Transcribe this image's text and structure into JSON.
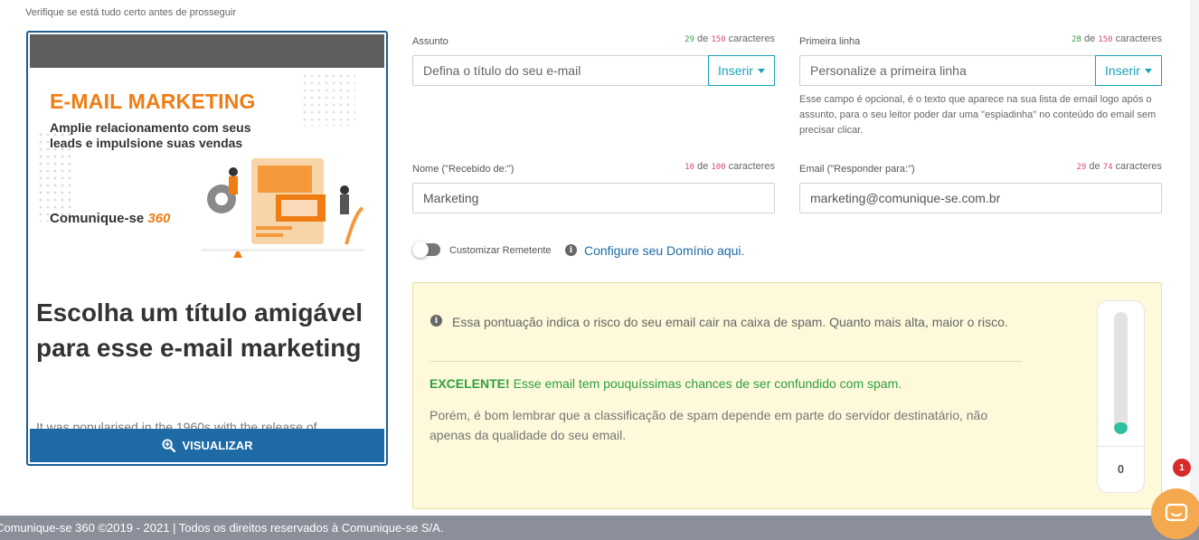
{
  "top_hint": "Verifique se está tudo certo antes de prosseguir",
  "preview": {
    "banner_title": "E-MAIL MARKETING",
    "banner_subtitle": "Amplie relacionamento com seus leads e impulsione suas vendas",
    "logo_text": "Comunique-se",
    "logo_number": "360",
    "heading": "Escolha um título amigável para esse e-mail marketing",
    "paragraph": "It was popularised in the 1960s with the release of",
    "visualize_label": "VISUALIZAR"
  },
  "subject": {
    "label": "Assunto",
    "count": "29",
    "max": "150",
    "of": "de",
    "unit": "caracteres",
    "placeholder": "Defina o título do seu e-mail",
    "insert_label": "Inserir"
  },
  "first_line": {
    "label": "Primeira linha",
    "count": "28",
    "max": "150",
    "of": "de",
    "unit": "caracteres",
    "placeholder": "Personalize a primeira linha",
    "insert_label": "Inserir",
    "help": "Esse campo é opcional, é o texto que aparece na sua lista de email logo após o assunto, para o seu leitor poder dar uma \"espiadinha\" no conteúdo do email sem precisar clicar."
  },
  "sender_name": {
    "label": "Nome (\"Recebido de:\")",
    "count": "10",
    "max": "100",
    "of": "de",
    "unit": "caracteres",
    "value": "Marketing"
  },
  "reply_email": {
    "label": "Email (\"Responder para:\")",
    "count": "29",
    "max": "74",
    "of": "de",
    "unit": "caracteres",
    "value": "marketing@comunique-se.com.br"
  },
  "custom_sender": {
    "label": "Customizar Remetente",
    "enabled": false,
    "link": "Configure seu Domínio aqui."
  },
  "spam": {
    "info": "Essa pontuação indica o risco do seu email cair na caixa de spam. Quanto mais alta, maior o risco.",
    "status_strong": "EXCELENTE!",
    "status_text": " Esse email tem pouquíssimas chances de ser confundido com spam.",
    "note": "Porém, é bom lembrar que a classificação de spam depende em parte do servidor destinatário, não apenas da qualidade do seu email.",
    "score": "0",
    "fill_fraction": 0.1
  },
  "footer": "Comunique-se 360 ©2019 - 2021 | Todos os direitos reservados à Comunique-se S/A.",
  "chat": {
    "badge_count": "1"
  },
  "colors": {
    "accent": "#1d6aa5",
    "insert": "#19a2b8",
    "ok": "#2ea043",
    "orange": "#f07d13",
    "gauge": "#2dbfa0"
  }
}
